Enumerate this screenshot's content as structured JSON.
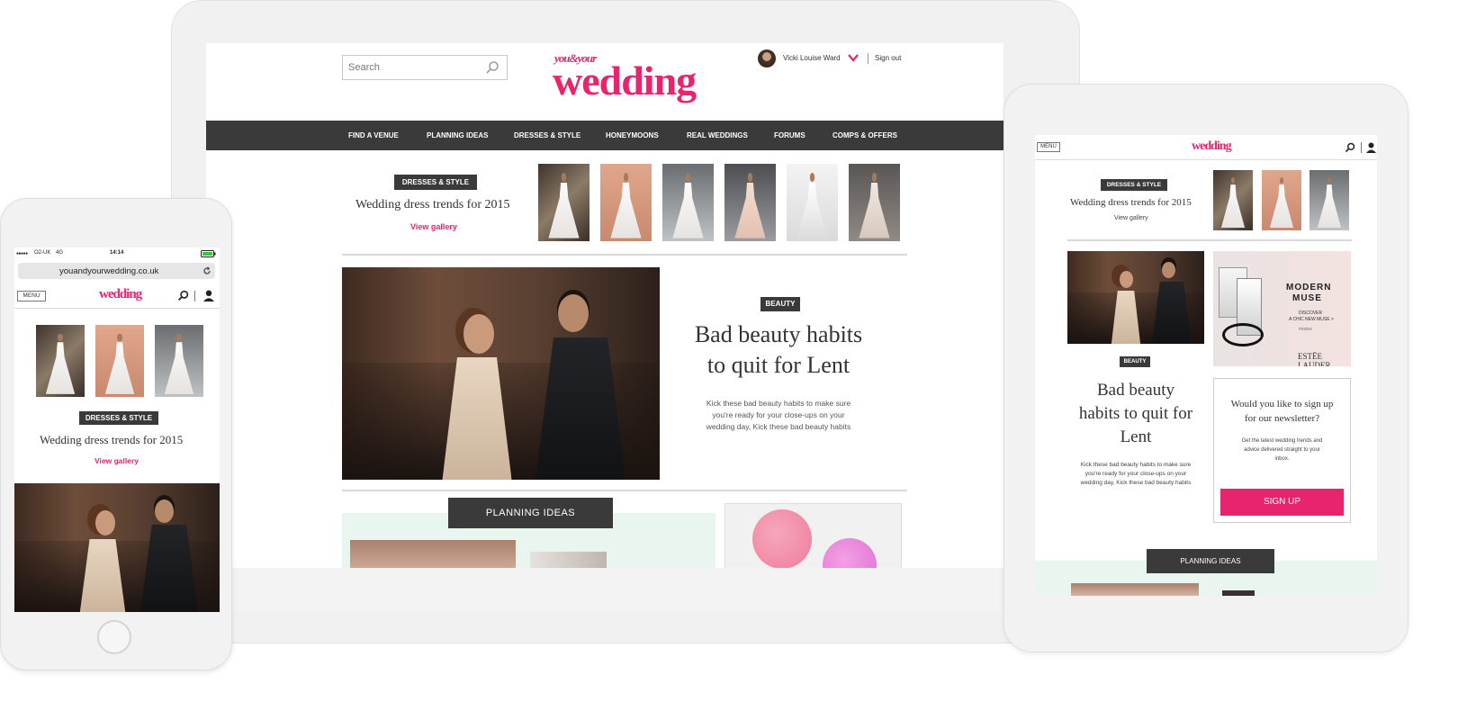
{
  "brand": {
    "logo_top": "you&your",
    "logo_main": "wedding",
    "logo_small": "wedding",
    "pink": "#e8246e",
    "dark": "#3a3a3a"
  },
  "desktop": {
    "search_placeholder": "Search",
    "user_name": "Vicki Louise Ward",
    "sign_out": "Sign out",
    "nav": [
      "FIND A VENUE",
      "PLANNING IDEAS",
      "DRESSES & STYLE",
      "HONEYMOONS",
      "REAL WEDDINGS",
      "FORUMS",
      "COMPS & OFFERS"
    ],
    "gallery": {
      "tag": "DRESSES & STYLE",
      "title": "Wedding dress trends for 2015",
      "link": "View gallery"
    },
    "feature": {
      "tag": "BEAUTY",
      "title_line1": "Bad beauty habits",
      "title_line2": "to quit for Lent",
      "desc_line1": "Kick these bad beauty habits to make sure",
      "desc_line2": "you're ready for your close-ups on your",
      "desc_line3": "wedding day, Kick these bad beauty habits"
    },
    "planning_tag": "PLANNING IDEAS"
  },
  "tablet": {
    "menu": "MENU",
    "gallery": {
      "tag": "DRESSES & STYLE",
      "title": "Wedding dress trends for 2015",
      "link": "View gallery"
    },
    "ad": {
      "title_line1": "MODERN",
      "title_line2": "MUSE",
      "line1": "DISCOVER",
      "line2": "A CHIC NEW MUSE >",
      "hashtag": "#estee",
      "brand": "ESTĒE LAUDER"
    },
    "feature": {
      "tag": "BEAUTY",
      "title_line1": "Bad beauty",
      "title_line2": "habits to quit for",
      "title_line3": "Lent",
      "desc_line1": "Kick these bad beauty habits to make sure",
      "desc_line2": "you're ready for your close-ups on your",
      "desc_line3": "wedding day, Kick these bad beauty habits"
    },
    "newsletter": {
      "q_line1": "Would you like to sign up",
      "q_line2": "for our newsletter?",
      "desc_line1": "Get the latest wedding trends and",
      "desc_line2": "advice delivered straight to your",
      "desc_line3": "inbox.",
      "button": "SIGN UP"
    },
    "planning_tag": "PLANNING IDEAS"
  },
  "phone": {
    "status": {
      "carrier": "O2-UK",
      "network": "4G",
      "time": "14:14"
    },
    "url": "youandyourwedding.co.uk",
    "menu": "MENU",
    "gallery": {
      "tag": "DRESSES & STYLE",
      "title": "Wedding dress trends for 2015",
      "link": "View gallery"
    }
  }
}
